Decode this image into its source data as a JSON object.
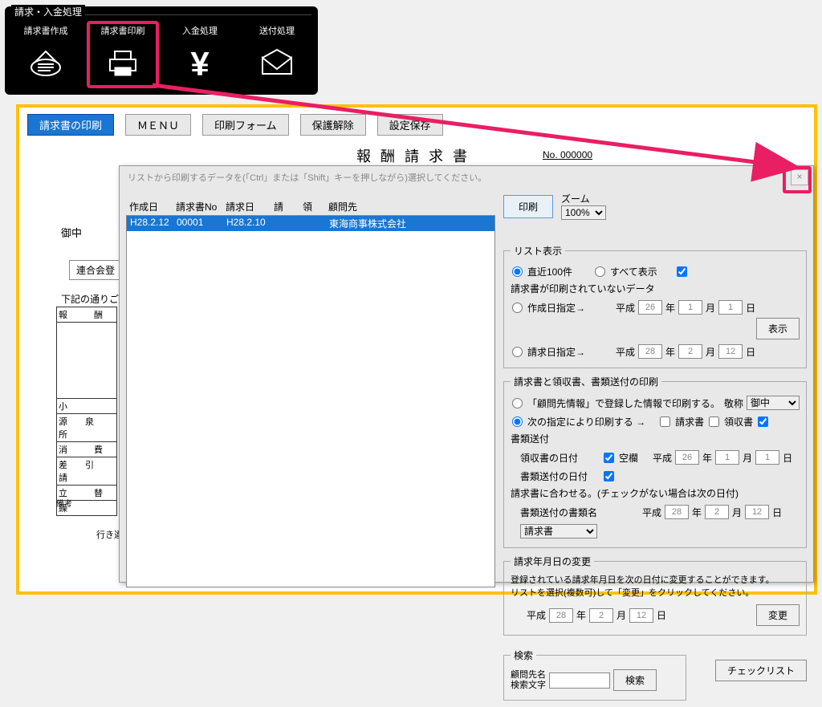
{
  "toolbar": {
    "group_title": "請求・入金処理",
    "items": [
      {
        "label": "請求書作成"
      },
      {
        "label": "請求書印刷"
      },
      {
        "label": "入金処理"
      },
      {
        "label": "送付処理"
      }
    ]
  },
  "top_buttons": {
    "print_invoice": "請求書の印刷",
    "menu": "ＭＥＮＵ",
    "print_form": "印刷フォーム",
    "unprotect": "保護解除",
    "save_settings": "設定保存"
  },
  "doc": {
    "title": "報酬請求書",
    "number": "No. 000000",
    "onchu": "御中",
    "rengou": "連合会登",
    "note": "下記の通りご",
    "table_rows": [
      "報　　　酬",
      "小",
      "源　　泉　　所",
      "消　　　費",
      "差　　引　　請",
      "立　　　替",
      "繰"
    ],
    "bikou": "備考",
    "footer": "行き違いに"
  },
  "dialog": {
    "instruction": "リストから印刷するデータを(「Ctrl」または「Shift」キーを押しながら)選択してください。",
    "close": "×",
    "list_headers": [
      "作成日",
      "請求書No",
      "請求日",
      "請　　領",
      "顧問先"
    ],
    "list_row": {
      "date": "H28.2.12",
      "no": "00001",
      "bill": "H28.2.10",
      "ryo": "",
      "client": "東海商事株式会社"
    },
    "print_btn": "印刷",
    "zoom_label": "ズーム",
    "zoom_value": "100%",
    "list_display": {
      "legend": "リスト表示",
      "recent100": "直近100件",
      "all": "すべて表示",
      "unprinted": "請求書が印刷されていないデータ",
      "by_created": "作成日指定→",
      "by_billed": "請求日指定→",
      "era": "平成",
      "y1": "26",
      "m1": "1",
      "d1": "1",
      "y2": "28",
      "m2": "2",
      "d2": "12",
      "year_lbl": "年",
      "month_lbl": "月",
      "day_lbl": "日",
      "show_btn": "表示"
    },
    "print_opts": {
      "legend": "請求書と領収書、書類送付の印刷",
      "use_client_info": "「顧問先情報」で登録した情報で印刷する。",
      "honorific_lbl": "敬称",
      "honorific_val": "御中",
      "use_following": "次の指定により印刷する →",
      "invoice": "請求書",
      "receipt": "領収書",
      "docsend": "書類送付",
      "receipt_date_lbl": "領収書の日付",
      "blank": "空欄",
      "era": "平成",
      "y": "26",
      "m": "1",
      "d": "1",
      "docsend_date_lbl": "書類送付の日付",
      "match_invoice": "請求書に合わせる。(チェックがない場合は次の日付)",
      "docsend_type_lbl": "書類送付の書類名",
      "docsend_type_val": "請求書",
      "y2": "28",
      "m2": "2",
      "d2": "12"
    },
    "change_date": {
      "legend": "請求年月日の変更",
      "note1": "登録されている請求年月日を次の日付に変更することができます。",
      "note2": "リストを選択(複数可)して「変更」をクリックしてください。",
      "era": "平成",
      "y": "28",
      "m": "2",
      "d": "12",
      "year_lbl": "年",
      "month_lbl": "月",
      "day_lbl": "日",
      "btn": "変更"
    },
    "search": {
      "legend": "検索",
      "label": "顧問先名\n検索文字",
      "btn": "検索"
    },
    "checklist_btn": "チェックリスト"
  }
}
